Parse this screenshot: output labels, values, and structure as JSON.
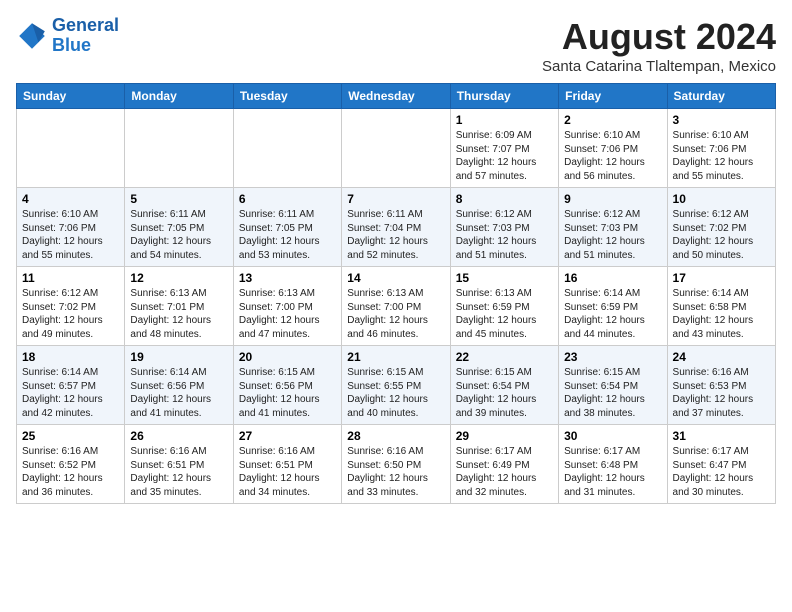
{
  "header": {
    "logo_line1": "General",
    "logo_line2": "Blue",
    "month_year": "August 2024",
    "location": "Santa Catarina Tlaltempan, Mexico"
  },
  "weekdays": [
    "Sunday",
    "Monday",
    "Tuesday",
    "Wednesday",
    "Thursday",
    "Friday",
    "Saturday"
  ],
  "weeks": [
    [
      {
        "day": "",
        "info": ""
      },
      {
        "day": "",
        "info": ""
      },
      {
        "day": "",
        "info": ""
      },
      {
        "day": "",
        "info": ""
      },
      {
        "day": "1",
        "info": "Sunrise: 6:09 AM\nSunset: 7:07 PM\nDaylight: 12 hours\nand 57 minutes."
      },
      {
        "day": "2",
        "info": "Sunrise: 6:10 AM\nSunset: 7:06 PM\nDaylight: 12 hours\nand 56 minutes."
      },
      {
        "day": "3",
        "info": "Sunrise: 6:10 AM\nSunset: 7:06 PM\nDaylight: 12 hours\nand 55 minutes."
      }
    ],
    [
      {
        "day": "4",
        "info": "Sunrise: 6:10 AM\nSunset: 7:06 PM\nDaylight: 12 hours\nand 55 minutes."
      },
      {
        "day": "5",
        "info": "Sunrise: 6:11 AM\nSunset: 7:05 PM\nDaylight: 12 hours\nand 54 minutes."
      },
      {
        "day": "6",
        "info": "Sunrise: 6:11 AM\nSunset: 7:05 PM\nDaylight: 12 hours\nand 53 minutes."
      },
      {
        "day": "7",
        "info": "Sunrise: 6:11 AM\nSunset: 7:04 PM\nDaylight: 12 hours\nand 52 minutes."
      },
      {
        "day": "8",
        "info": "Sunrise: 6:12 AM\nSunset: 7:03 PM\nDaylight: 12 hours\nand 51 minutes."
      },
      {
        "day": "9",
        "info": "Sunrise: 6:12 AM\nSunset: 7:03 PM\nDaylight: 12 hours\nand 51 minutes."
      },
      {
        "day": "10",
        "info": "Sunrise: 6:12 AM\nSunset: 7:02 PM\nDaylight: 12 hours\nand 50 minutes."
      }
    ],
    [
      {
        "day": "11",
        "info": "Sunrise: 6:12 AM\nSunset: 7:02 PM\nDaylight: 12 hours\nand 49 minutes."
      },
      {
        "day": "12",
        "info": "Sunrise: 6:13 AM\nSunset: 7:01 PM\nDaylight: 12 hours\nand 48 minutes."
      },
      {
        "day": "13",
        "info": "Sunrise: 6:13 AM\nSunset: 7:00 PM\nDaylight: 12 hours\nand 47 minutes."
      },
      {
        "day": "14",
        "info": "Sunrise: 6:13 AM\nSunset: 7:00 PM\nDaylight: 12 hours\nand 46 minutes."
      },
      {
        "day": "15",
        "info": "Sunrise: 6:13 AM\nSunset: 6:59 PM\nDaylight: 12 hours\nand 45 minutes."
      },
      {
        "day": "16",
        "info": "Sunrise: 6:14 AM\nSunset: 6:59 PM\nDaylight: 12 hours\nand 44 minutes."
      },
      {
        "day": "17",
        "info": "Sunrise: 6:14 AM\nSunset: 6:58 PM\nDaylight: 12 hours\nand 43 minutes."
      }
    ],
    [
      {
        "day": "18",
        "info": "Sunrise: 6:14 AM\nSunset: 6:57 PM\nDaylight: 12 hours\nand 42 minutes."
      },
      {
        "day": "19",
        "info": "Sunrise: 6:14 AM\nSunset: 6:56 PM\nDaylight: 12 hours\nand 41 minutes."
      },
      {
        "day": "20",
        "info": "Sunrise: 6:15 AM\nSunset: 6:56 PM\nDaylight: 12 hours\nand 41 minutes."
      },
      {
        "day": "21",
        "info": "Sunrise: 6:15 AM\nSunset: 6:55 PM\nDaylight: 12 hours\nand 40 minutes."
      },
      {
        "day": "22",
        "info": "Sunrise: 6:15 AM\nSunset: 6:54 PM\nDaylight: 12 hours\nand 39 minutes."
      },
      {
        "day": "23",
        "info": "Sunrise: 6:15 AM\nSunset: 6:54 PM\nDaylight: 12 hours\nand 38 minutes."
      },
      {
        "day": "24",
        "info": "Sunrise: 6:16 AM\nSunset: 6:53 PM\nDaylight: 12 hours\nand 37 minutes."
      }
    ],
    [
      {
        "day": "25",
        "info": "Sunrise: 6:16 AM\nSunset: 6:52 PM\nDaylight: 12 hours\nand 36 minutes."
      },
      {
        "day": "26",
        "info": "Sunrise: 6:16 AM\nSunset: 6:51 PM\nDaylight: 12 hours\nand 35 minutes."
      },
      {
        "day": "27",
        "info": "Sunrise: 6:16 AM\nSunset: 6:51 PM\nDaylight: 12 hours\nand 34 minutes."
      },
      {
        "day": "28",
        "info": "Sunrise: 6:16 AM\nSunset: 6:50 PM\nDaylight: 12 hours\nand 33 minutes."
      },
      {
        "day": "29",
        "info": "Sunrise: 6:17 AM\nSunset: 6:49 PM\nDaylight: 12 hours\nand 32 minutes."
      },
      {
        "day": "30",
        "info": "Sunrise: 6:17 AM\nSunset: 6:48 PM\nDaylight: 12 hours\nand 31 minutes."
      },
      {
        "day": "31",
        "info": "Sunrise: 6:17 AM\nSunset: 6:47 PM\nDaylight: 12 hours\nand 30 minutes."
      }
    ]
  ]
}
